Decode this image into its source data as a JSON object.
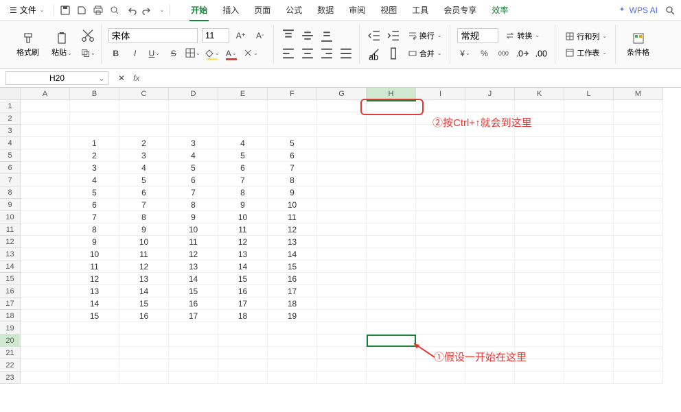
{
  "menu": {
    "file": "文件",
    "tabs": [
      "开始",
      "插入",
      "页面",
      "公式",
      "数据",
      "审阅",
      "视图",
      "工具",
      "会员专享",
      "效率"
    ],
    "active_tab": 0,
    "wps_ai": "WPS AI"
  },
  "ribbon": {
    "format_painter": "格式刷",
    "paste": "粘贴",
    "font": "宋体",
    "font_size": "11",
    "wrap_text": "换行",
    "merge": "合并",
    "number_format": "常规",
    "convert": "转换",
    "rows_cols": "行和列",
    "worksheet": "工作表",
    "conditional": "条件格",
    "currency_prefix": "¥",
    "currency_sep": "000"
  },
  "formula_bar": {
    "cell_ref": "H20",
    "formula": ""
  },
  "grid": {
    "columns": [
      "A",
      "B",
      "C",
      "D",
      "E",
      "F",
      "G",
      "H",
      "I",
      "J",
      "K",
      "L",
      "M"
    ],
    "visible_rows": 23,
    "selected_col_idx": 7,
    "selected_row_idx": 20,
    "data": [
      {
        "r": 4,
        "c": 1,
        "v": "1"
      },
      {
        "r": 4,
        "c": 2,
        "v": "2"
      },
      {
        "r": 4,
        "c": 3,
        "v": "3"
      },
      {
        "r": 4,
        "c": 4,
        "v": "4"
      },
      {
        "r": 4,
        "c": 5,
        "v": "5"
      },
      {
        "r": 5,
        "c": 1,
        "v": "2"
      },
      {
        "r": 5,
        "c": 2,
        "v": "3"
      },
      {
        "r": 5,
        "c": 3,
        "v": "4"
      },
      {
        "r": 5,
        "c": 4,
        "v": "5"
      },
      {
        "r": 5,
        "c": 5,
        "v": "6"
      },
      {
        "r": 6,
        "c": 1,
        "v": "3"
      },
      {
        "r": 6,
        "c": 2,
        "v": "4"
      },
      {
        "r": 6,
        "c": 3,
        "v": "5"
      },
      {
        "r": 6,
        "c": 4,
        "v": "6"
      },
      {
        "r": 6,
        "c": 5,
        "v": "7"
      },
      {
        "r": 7,
        "c": 1,
        "v": "4"
      },
      {
        "r": 7,
        "c": 2,
        "v": "5"
      },
      {
        "r": 7,
        "c": 3,
        "v": "6"
      },
      {
        "r": 7,
        "c": 4,
        "v": "7"
      },
      {
        "r": 7,
        "c": 5,
        "v": "8"
      },
      {
        "r": 8,
        "c": 1,
        "v": "5"
      },
      {
        "r": 8,
        "c": 2,
        "v": "6"
      },
      {
        "r": 8,
        "c": 3,
        "v": "7"
      },
      {
        "r": 8,
        "c": 4,
        "v": "8"
      },
      {
        "r": 8,
        "c": 5,
        "v": "9"
      },
      {
        "r": 9,
        "c": 1,
        "v": "6"
      },
      {
        "r": 9,
        "c": 2,
        "v": "7"
      },
      {
        "r": 9,
        "c": 3,
        "v": "8"
      },
      {
        "r": 9,
        "c": 4,
        "v": "9"
      },
      {
        "r": 9,
        "c": 5,
        "v": "10"
      },
      {
        "r": 10,
        "c": 1,
        "v": "7"
      },
      {
        "r": 10,
        "c": 2,
        "v": "8"
      },
      {
        "r": 10,
        "c": 3,
        "v": "9"
      },
      {
        "r": 10,
        "c": 4,
        "v": "10"
      },
      {
        "r": 10,
        "c": 5,
        "v": "11"
      },
      {
        "r": 11,
        "c": 1,
        "v": "8"
      },
      {
        "r": 11,
        "c": 2,
        "v": "9"
      },
      {
        "r": 11,
        "c": 3,
        "v": "10"
      },
      {
        "r": 11,
        "c": 4,
        "v": "11"
      },
      {
        "r": 11,
        "c": 5,
        "v": "12"
      },
      {
        "r": 12,
        "c": 1,
        "v": "9"
      },
      {
        "r": 12,
        "c": 2,
        "v": "10"
      },
      {
        "r": 12,
        "c": 3,
        "v": "11"
      },
      {
        "r": 12,
        "c": 4,
        "v": "12"
      },
      {
        "r": 12,
        "c": 5,
        "v": "13"
      },
      {
        "r": 13,
        "c": 1,
        "v": "10"
      },
      {
        "r": 13,
        "c": 2,
        "v": "11"
      },
      {
        "r": 13,
        "c": 3,
        "v": "12"
      },
      {
        "r": 13,
        "c": 4,
        "v": "13"
      },
      {
        "r": 13,
        "c": 5,
        "v": "14"
      },
      {
        "r": 14,
        "c": 1,
        "v": "11"
      },
      {
        "r": 14,
        "c": 2,
        "v": "12"
      },
      {
        "r": 14,
        "c": 3,
        "v": "13"
      },
      {
        "r": 14,
        "c": 4,
        "v": "14"
      },
      {
        "r": 14,
        "c": 5,
        "v": "15"
      },
      {
        "r": 15,
        "c": 1,
        "v": "12"
      },
      {
        "r": 15,
        "c": 2,
        "v": "13"
      },
      {
        "r": 15,
        "c": 3,
        "v": "14"
      },
      {
        "r": 15,
        "c": 4,
        "v": "15"
      },
      {
        "r": 15,
        "c": 5,
        "v": "16"
      },
      {
        "r": 16,
        "c": 1,
        "v": "13"
      },
      {
        "r": 16,
        "c": 2,
        "v": "14"
      },
      {
        "r": 16,
        "c": 3,
        "v": "15"
      },
      {
        "r": 16,
        "c": 4,
        "v": "16"
      },
      {
        "r": 16,
        "c": 5,
        "v": "17"
      },
      {
        "r": 17,
        "c": 1,
        "v": "14"
      },
      {
        "r": 17,
        "c": 2,
        "v": "15"
      },
      {
        "r": 17,
        "c": 3,
        "v": "16"
      },
      {
        "r": 17,
        "c": 4,
        "v": "17"
      },
      {
        "r": 17,
        "c": 5,
        "v": "18"
      },
      {
        "r": 18,
        "c": 1,
        "v": "15"
      },
      {
        "r": 18,
        "c": 2,
        "v": "16"
      },
      {
        "r": 18,
        "c": 3,
        "v": "17"
      },
      {
        "r": 18,
        "c": 4,
        "v": "18"
      },
      {
        "r": 18,
        "c": 5,
        "v": "19"
      }
    ]
  },
  "annotations": {
    "note2": "②按Ctrl+↑就会到这里",
    "note1": "①假设一开始在这里"
  }
}
